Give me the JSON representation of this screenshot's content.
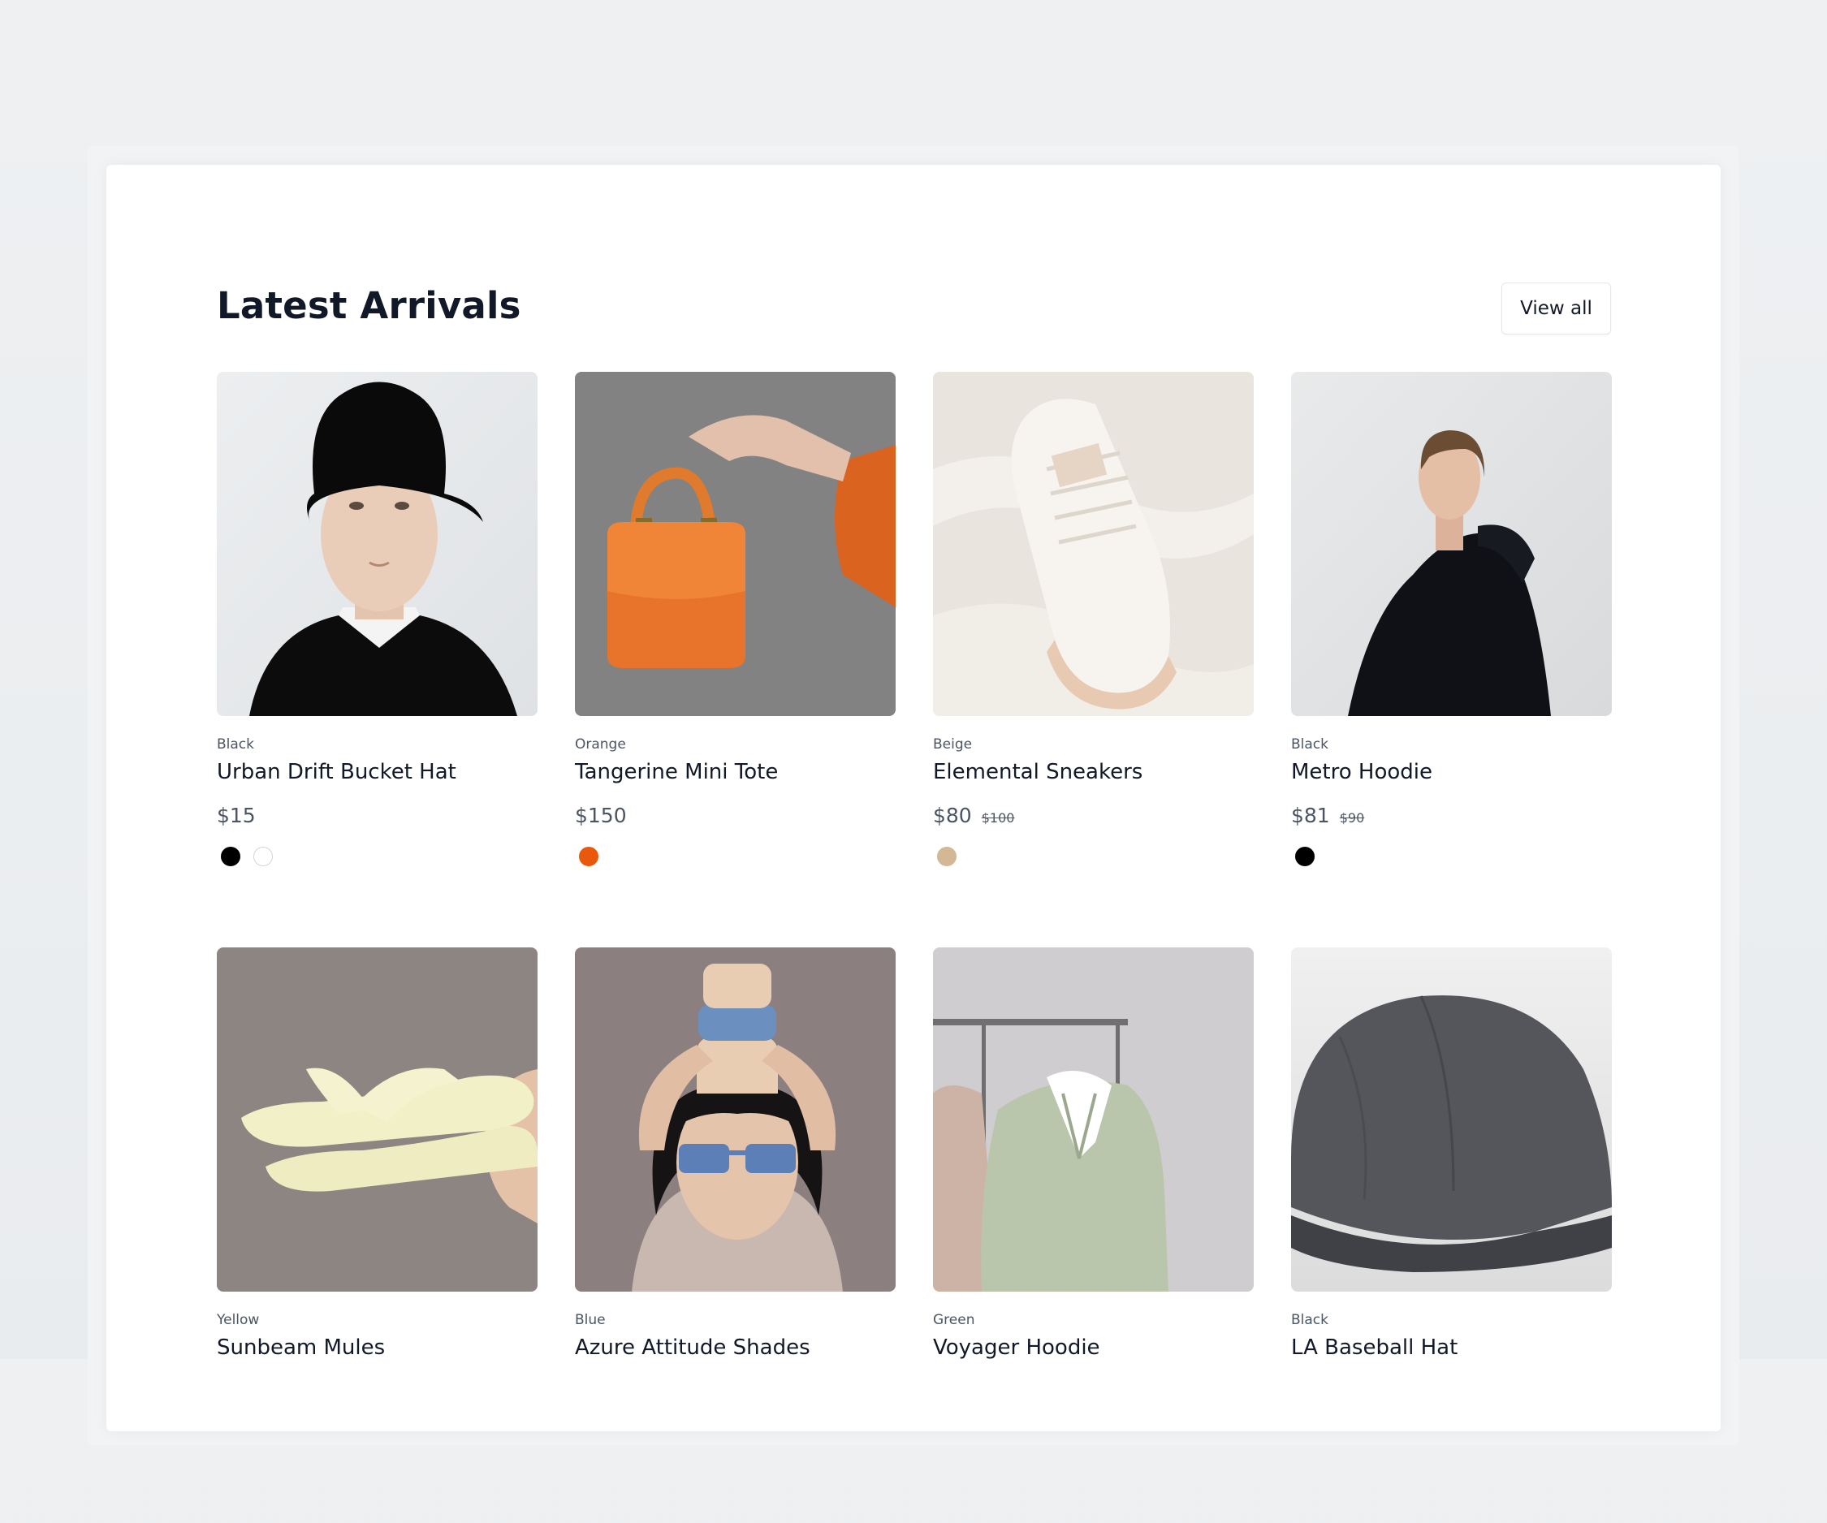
{
  "section": {
    "title": "Latest Arrivals",
    "view_all_label": "View all"
  },
  "products": [
    {
      "variant": "Black",
      "name": "Urban Drift Bucket Hat",
      "price": "$15",
      "old_price": "",
      "image_icon": "bucket-hat-photo",
      "swatches": [
        "#000000",
        "#ffffff"
      ]
    },
    {
      "variant": "Orange",
      "name": "Tangerine Mini Tote",
      "price": "$150",
      "old_price": "",
      "image_icon": "orange-tote-photo",
      "swatches": [
        "#ea580c"
      ]
    },
    {
      "variant": "Beige",
      "name": "Elemental Sneakers",
      "price": "$80",
      "old_price": "$100",
      "image_icon": "sneaker-photo",
      "swatches": [
        "#d4b896"
      ]
    },
    {
      "variant": "Black",
      "name": "Metro Hoodie",
      "price": "$81",
      "old_price": "$90",
      "image_icon": "black-hoodie-photo",
      "swatches": [
        "#000000"
      ]
    },
    {
      "variant": "Yellow",
      "name": "Sunbeam Mules",
      "price": "",
      "old_price": "",
      "image_icon": "yellow-mules-photo",
      "swatches": []
    },
    {
      "variant": "Blue",
      "name": "Azure Attitude Shades",
      "price": "",
      "old_price": "",
      "image_icon": "blue-sunglasses-photo",
      "swatches": []
    },
    {
      "variant": "Green",
      "name": "Voyager Hoodie",
      "price": "",
      "old_price": "",
      "image_icon": "green-hoodie-photo",
      "swatches": []
    },
    {
      "variant": "Black",
      "name": "LA Baseball Hat",
      "price": "",
      "old_price": "",
      "image_icon": "baseball-cap-photo",
      "swatches": []
    }
  ]
}
